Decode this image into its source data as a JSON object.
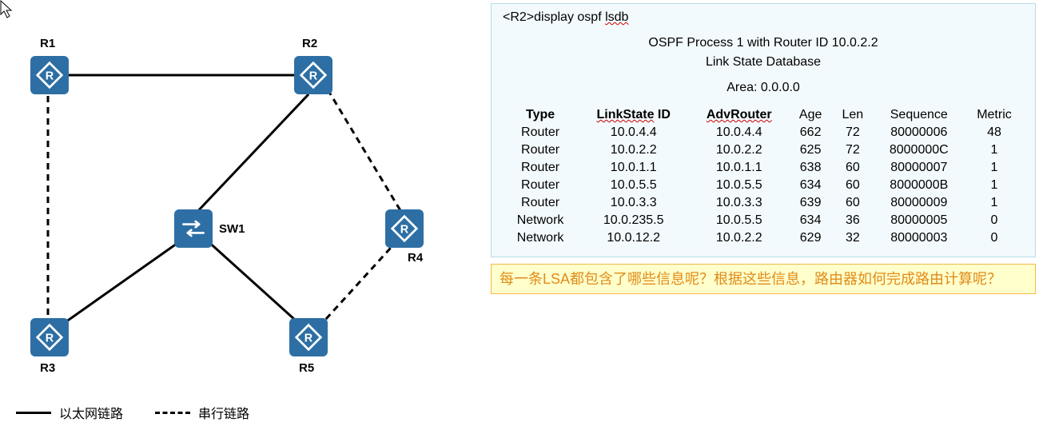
{
  "topology": {
    "nodes": {
      "R1": "R1",
      "R2": "R2",
      "R3": "R3",
      "R4": "R4",
      "R5": "R5",
      "SW1": "SW1"
    },
    "legend": {
      "ethernet": "以太网链路",
      "serial": "串行链路"
    }
  },
  "lsdb": {
    "cmd_prefix": "<R2>display ospf ",
    "cmd_word": "lsdb",
    "header_line1": "OSPF Process 1 with Router ID 10.0.2.2",
    "header_line2": "Link State Database",
    "area": "Area: 0.0.0.0",
    "columns": {
      "type": "Type",
      "lsid_pre": "LinkState",
      "lsid_suf": " ID",
      "adv": "AdvRouter",
      "age": "Age",
      "len": "Len",
      "seq": "Sequence",
      "metric": "Metric"
    },
    "rows": [
      {
        "type": "Router",
        "lsid": "10.0.4.4",
        "adv": "10.0.4.4",
        "age": "662",
        "len": "72",
        "seq": "80000006",
        "metric": "48"
      },
      {
        "type": "Router",
        "lsid": "10.0.2.2",
        "adv": "10.0.2.2",
        "age": "625",
        "len": "72",
        "seq": "8000000C",
        "metric": "1"
      },
      {
        "type": "Router",
        "lsid": "10.0.1.1",
        "adv": "10.0.1.1",
        "age": "638",
        "len": "60",
        "seq": "80000007",
        "metric": "1"
      },
      {
        "type": "Router",
        "lsid": "10.0.5.5",
        "adv": "10.0.5.5",
        "age": "634",
        "len": "60",
        "seq": "8000000B",
        "metric": "1"
      },
      {
        "type": "Router",
        "lsid": "10.0.3.3",
        "adv": "10.0.3.3",
        "age": "639",
        "len": "60",
        "seq": "80000009",
        "metric": "1"
      },
      {
        "type": "Network",
        "lsid": "10.0.235.5",
        "adv": "10.0.5.5",
        "age": "634",
        "len": "36",
        "seq": "80000005",
        "metric": "0"
      },
      {
        "type": "Network",
        "lsid": "10.0.12.2",
        "adv": "10.0.2.2",
        "age": "629",
        "len": "32",
        "seq": "80000003",
        "metric": "0"
      }
    ]
  },
  "question": "每一条LSA都包含了哪些信息呢？根据这些信息，路由器如何完成路由计算呢？"
}
